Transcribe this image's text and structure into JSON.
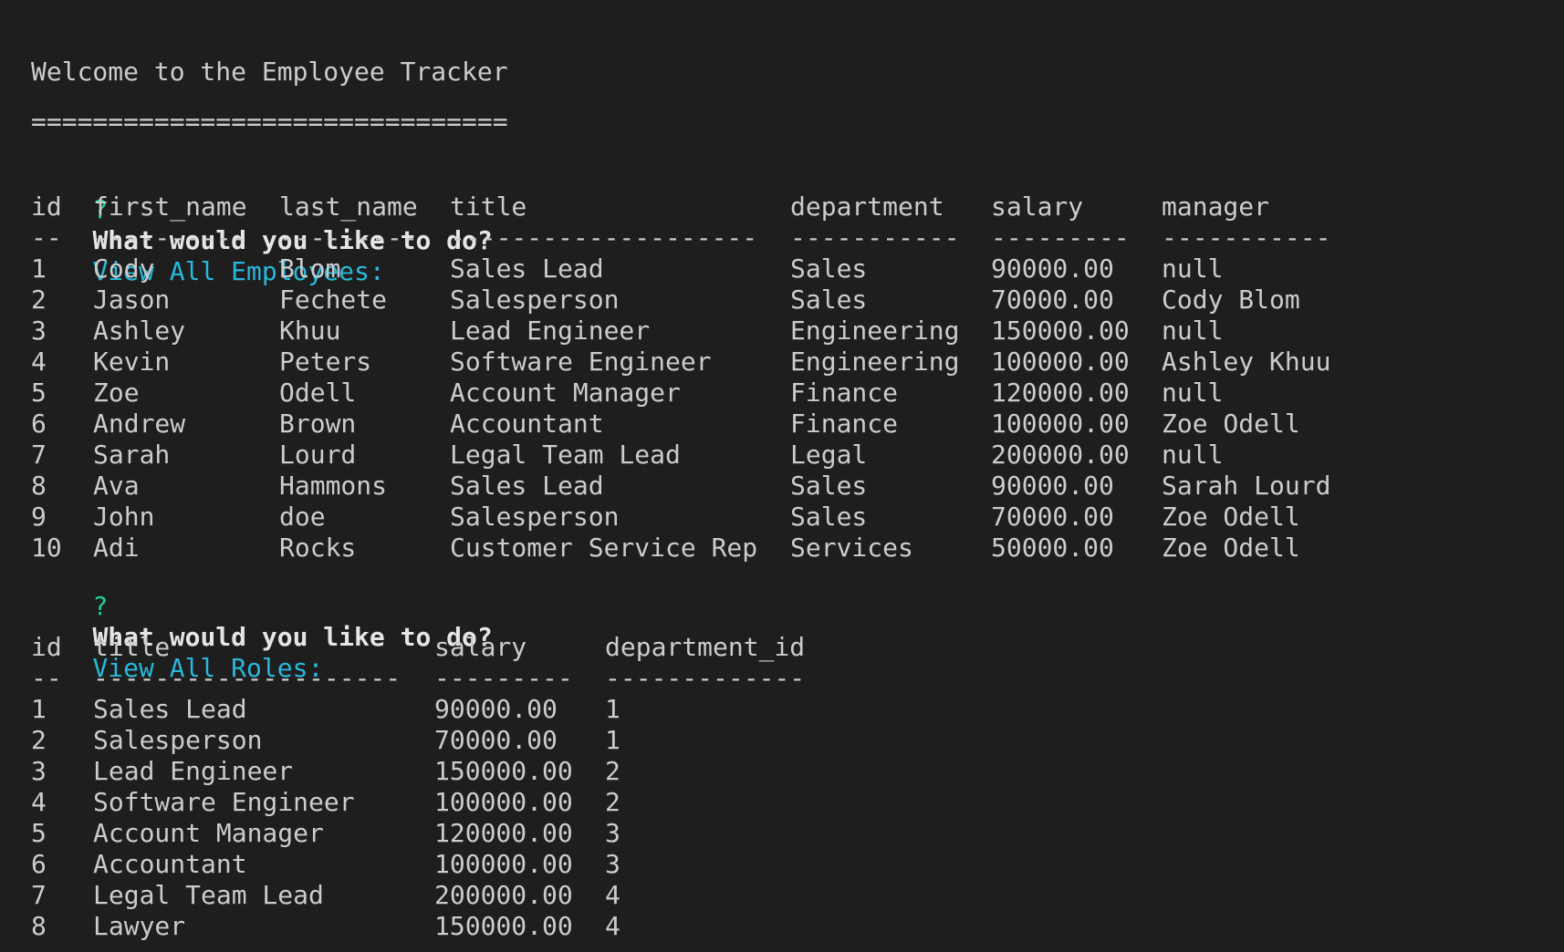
{
  "welcome": "Welcome to the Employee Tracker",
  "divider": "===============================",
  "prompts": [
    {
      "mark": "?",
      "question": "What would you like to do?",
      "answer": "View All Employees:"
    },
    {
      "mark": "?",
      "question": "What would you like to do?",
      "answer": "View All Roles:"
    }
  ],
  "employees": {
    "headers": [
      "id",
      "first_name",
      "last_name",
      "title",
      "department",
      "salary",
      "manager"
    ],
    "dividers": [
      "--",
      "----------",
      "---------",
      "--------------------",
      "-----------",
      "---------",
      "-----------"
    ],
    "rows": [
      [
        "1",
        "Cody",
        "Blom",
        "Sales Lead",
        "Sales",
        "90000.00",
        "null"
      ],
      [
        "2",
        "Jason",
        "Fechete",
        "Salesperson",
        "Sales",
        "70000.00",
        "Cody Blom"
      ],
      [
        "3",
        "Ashley",
        "Khuu",
        "Lead Engineer",
        "Engineering",
        "150000.00",
        "null"
      ],
      [
        "4",
        "Kevin",
        "Peters",
        "Software Engineer",
        "Engineering",
        "100000.00",
        "Ashley Khuu"
      ],
      [
        "5",
        "Zoe",
        "Odell",
        "Account Manager",
        "Finance",
        "120000.00",
        "null"
      ],
      [
        "6",
        "Andrew",
        "Brown",
        "Accountant",
        "Finance",
        "100000.00",
        "Zoe Odell"
      ],
      [
        "7",
        "Sarah",
        "Lourd",
        "Legal Team Lead",
        "Legal",
        "200000.00",
        "null"
      ],
      [
        "8",
        "Ava",
        "Hammons",
        "Sales Lead",
        "Sales",
        "90000.00",
        "Sarah Lourd"
      ],
      [
        "9",
        "John",
        "doe",
        "Salesperson",
        "Sales",
        "70000.00",
        "Zoe Odell"
      ],
      [
        "10",
        "Adi",
        "Rocks",
        "Customer Service Rep",
        "Services",
        "50000.00",
        "Zoe Odell"
      ]
    ]
  },
  "roles": {
    "headers": [
      "id",
      "title",
      "salary",
      "department_id"
    ],
    "dividers": [
      "--",
      "--------------------",
      "---------",
      "-------------"
    ],
    "rows": [
      [
        "1",
        "Sales Lead",
        "90000.00",
        "1"
      ],
      [
        "2",
        "Salesperson",
        "70000.00",
        "1"
      ],
      [
        "3",
        "Lead Engineer",
        "150000.00",
        "2"
      ],
      [
        "4",
        "Software Engineer",
        "100000.00",
        "2"
      ],
      [
        "5",
        "Account Manager",
        "120000.00",
        "3"
      ],
      [
        "6",
        "Accountant",
        "100000.00",
        "3"
      ],
      [
        "7",
        "Legal Team Lead",
        "200000.00",
        "4"
      ],
      [
        "8",
        "Lawyer",
        "150000.00",
        "4"
      ]
    ]
  },
  "colors": {
    "background": "#1e1e1e",
    "text": "#cccccc",
    "question_mark": "#23d18b",
    "answer": "#29b8db"
  }
}
